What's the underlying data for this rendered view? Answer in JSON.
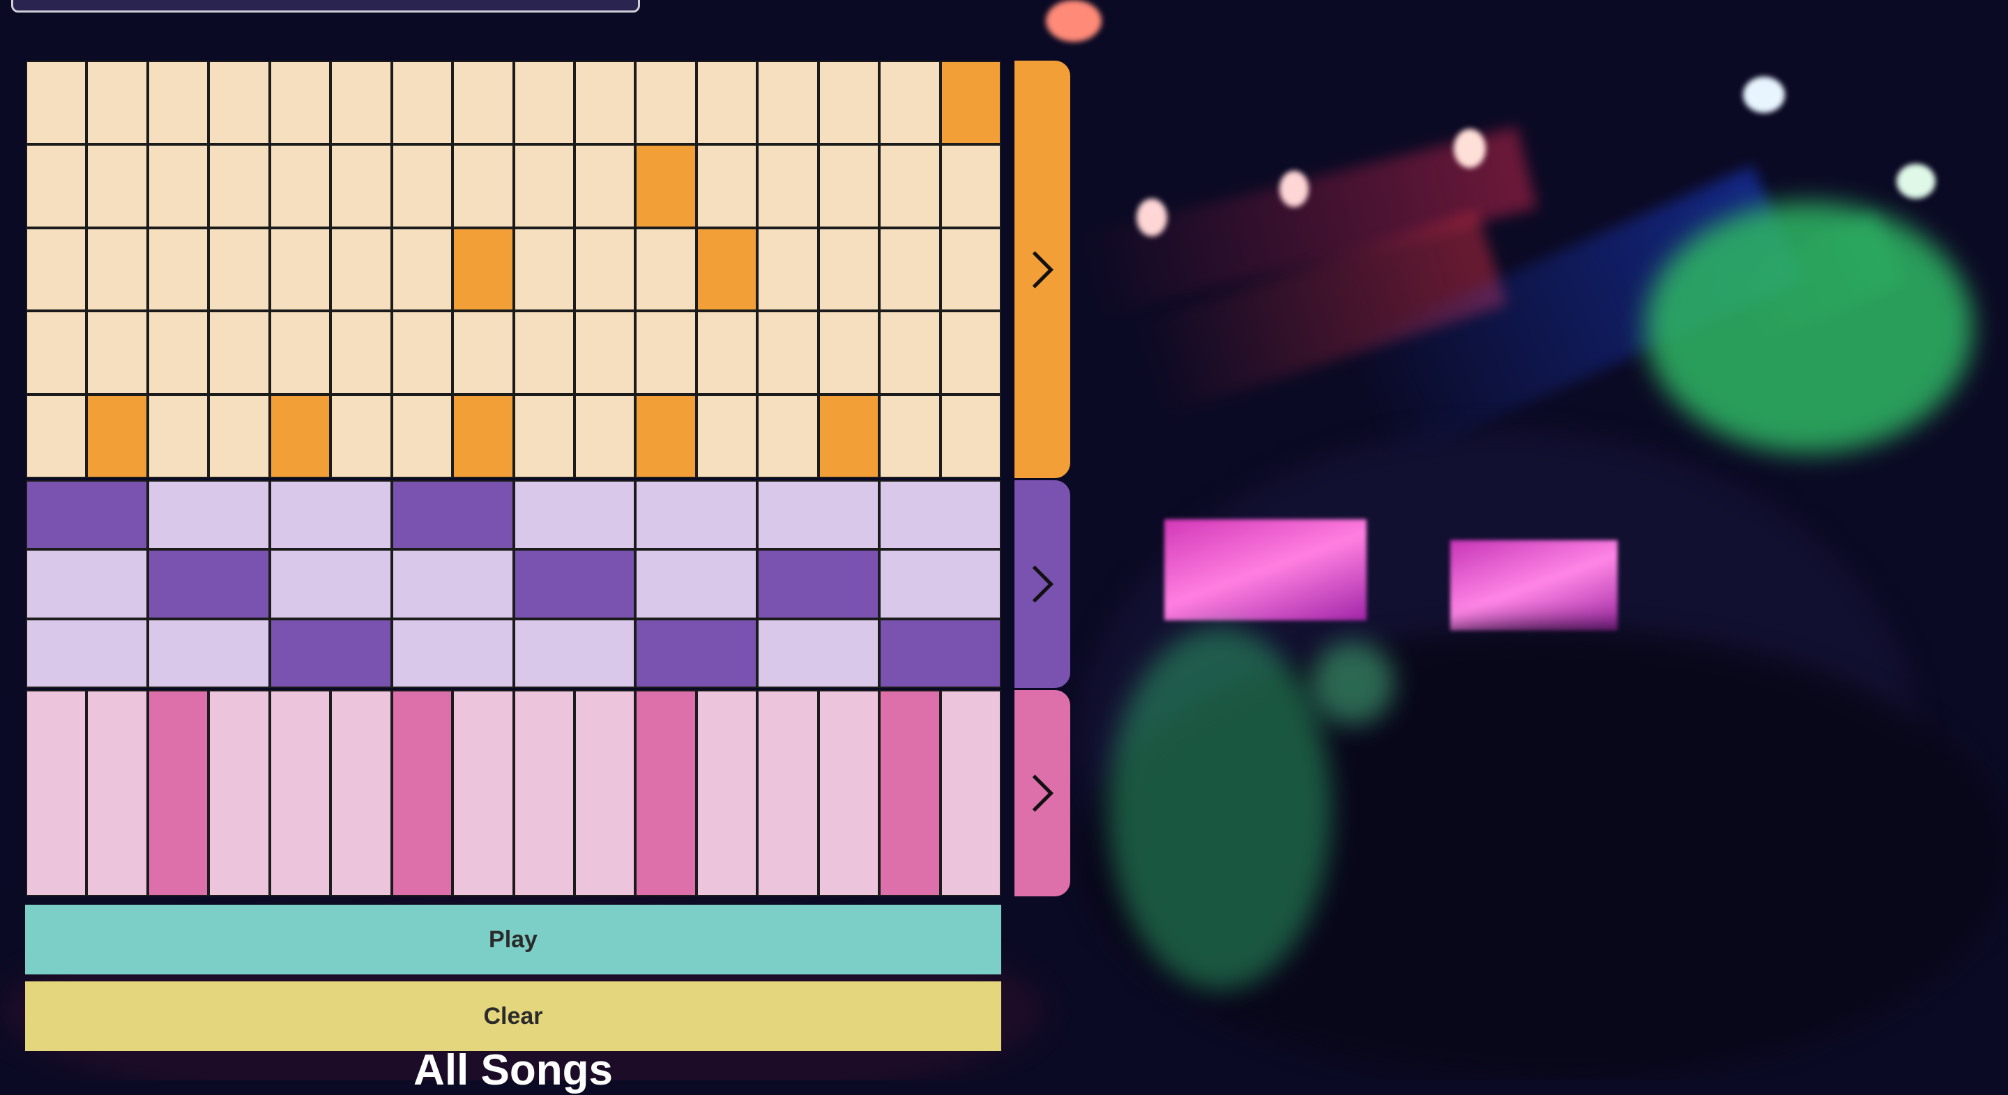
{
  "colors": {
    "orange_on": "#f29f38",
    "orange_off": "#f5dfbe",
    "purple_on": "#7a52b0",
    "purple_off": "#dac8ea",
    "pink_on": "#dd6fab",
    "pink_off": "#ecc5dc",
    "play_bg": "#7ccfc6",
    "clear_bg": "#e4d67d"
  },
  "sequencer": {
    "melody": {
      "steps": 16,
      "rows": [
        [
          0,
          0,
          0,
          0,
          0,
          0,
          0,
          0,
          0,
          0,
          0,
          0,
          0,
          0,
          0,
          1
        ],
        [
          0,
          0,
          0,
          0,
          0,
          0,
          0,
          0,
          0,
          0,
          1,
          0,
          0,
          0,
          0,
          0
        ],
        [
          0,
          0,
          0,
          0,
          0,
          0,
          0,
          1,
          0,
          0,
          0,
          1,
          0,
          0,
          0,
          0
        ],
        [
          0,
          0,
          0,
          0,
          0,
          0,
          0,
          0,
          0,
          0,
          0,
          0,
          0,
          0,
          0,
          0
        ],
        [
          0,
          1,
          0,
          0,
          1,
          0,
          0,
          1,
          0,
          0,
          1,
          0,
          0,
          1,
          0,
          0
        ]
      ],
      "next_icon": "chevron-right-icon"
    },
    "chords": {
      "steps": 8,
      "rows": [
        [
          1,
          0,
          0,
          1,
          0,
          0,
          0,
          0
        ],
        [
          0,
          1,
          0,
          0,
          1,
          0,
          1,
          0
        ],
        [
          0,
          0,
          1,
          0,
          0,
          1,
          0,
          1
        ]
      ],
      "next_icon": "chevron-right-icon"
    },
    "drums": {
      "steps": 16,
      "rows": [
        [
          0,
          0,
          1,
          0,
          0,
          0,
          1,
          0,
          0,
          0,
          1,
          0,
          0,
          0,
          1,
          0
        ]
      ],
      "next_icon": "chevron-right-icon"
    }
  },
  "controls": {
    "play_label": "Play",
    "clear_label": "Clear"
  },
  "songs": {
    "heading": "All Songs"
  }
}
